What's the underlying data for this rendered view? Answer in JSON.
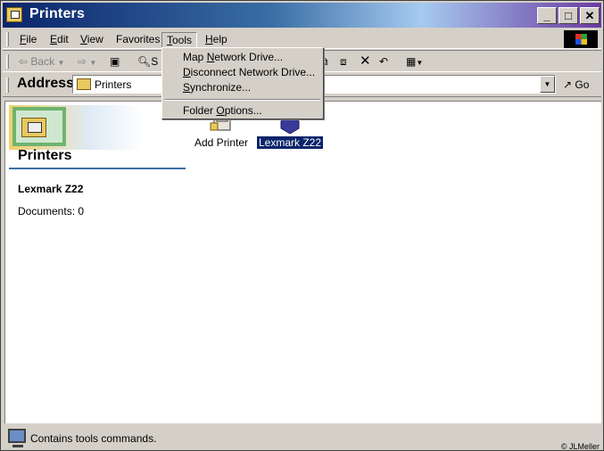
{
  "window": {
    "title": "Printers",
    "controls": {
      "minimize": "_",
      "maximize": "□",
      "close": "✕"
    }
  },
  "menubar": {
    "items": [
      {
        "label": "File",
        "key": "F",
        "rest": "ile"
      },
      {
        "label": "Edit",
        "key": "E",
        "rest": "dit"
      },
      {
        "label": "View",
        "key": "V",
        "rest": "iew"
      },
      {
        "label": "Favorites",
        "key": "",
        "rest": "Favorites"
      },
      {
        "label": "Tools",
        "key": "T",
        "rest": "ools"
      },
      {
        "label": "Help",
        "key": "H",
        "rest": "elp"
      }
    ],
    "active": "Tools"
  },
  "toolbar": {
    "back_label": "Back",
    "search_stub": "S"
  },
  "address": {
    "label": "Address",
    "value": "Printers",
    "go_label": "Go"
  },
  "tools_menu": {
    "items": [
      {
        "pre": "Map ",
        "key": "N",
        "post": "etwork Drive..."
      },
      {
        "pre": "",
        "key": "D",
        "post": "isconnect Network Drive..."
      },
      {
        "pre": "",
        "key": "S",
        "post": "ynchronize..."
      },
      {
        "pre": "Folder ",
        "key": "O",
        "post": "ptions..."
      }
    ]
  },
  "left_panel": {
    "title": "Printers",
    "selected_name": "Lexmark Z22",
    "documents": "Documents: 0"
  },
  "icons": [
    {
      "label": "Add Printer",
      "selected": false
    },
    {
      "label": "Lexmark Z22",
      "selected": true
    }
  ],
  "statusbar": {
    "text": "Contains tools commands.",
    "credit": "© JLMeller"
  }
}
